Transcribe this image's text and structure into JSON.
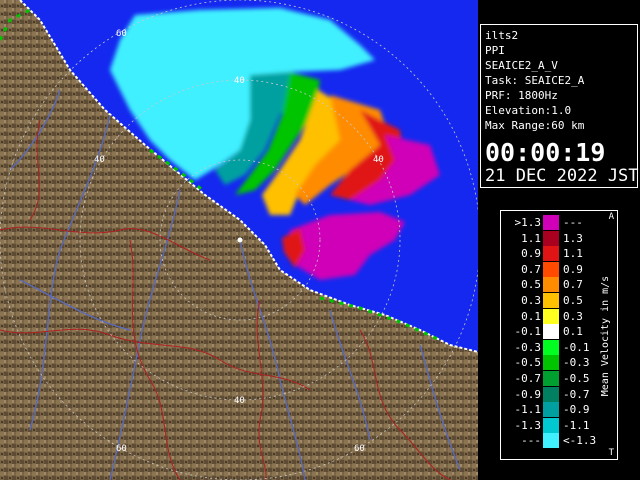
{
  "info": {
    "lines": [
      "ilts2",
      "PPI",
      "SEAICE2_A_V",
      "Task: SEAICE2_A",
      "PRF: 1800Hz",
      "Elevation:1.0",
      "Max Range:60 km"
    ],
    "time": "00:00:19",
    "date": "21 DEC 2022 JST"
  },
  "legend": {
    "unit": "Mean Velocity in m/s",
    "corner_top": "A",
    "corner_bottom": "T",
    "rows": [
      {
        "lo": ">1.3",
        "hi": "---",
        "color": "#d000b8"
      },
      {
        "lo": "1.1",
        "hi": "1.3",
        "color": "#a8001e"
      },
      {
        "lo": "0.9",
        "hi": "1.1",
        "color": "#e01414"
      },
      {
        "lo": "0.7",
        "hi": "0.9",
        "color": "#ff4a00"
      },
      {
        "lo": "0.5",
        "hi": "0.7",
        "color": "#ff8c00"
      },
      {
        "lo": "0.3",
        "hi": "0.5",
        "color": "#ffc000"
      },
      {
        "lo": "0.1",
        "hi": "0.3",
        "color": "#ffff20"
      },
      {
        "lo": "-0.1",
        "hi": "0.1",
        "color": "#ffffff"
      },
      {
        "lo": "-0.3",
        "hi": "-0.1",
        "color": "#00ff20"
      },
      {
        "lo": "-0.5",
        "hi": "-0.3",
        "color": "#00c400"
      },
      {
        "lo": "-0.7",
        "hi": "-0.5",
        "color": "#00a030"
      },
      {
        "lo": "-0.9",
        "hi": "-0.7",
        "color": "#008060"
      },
      {
        "lo": "-1.1",
        "hi": "-0.9",
        "color": "#00a0a0"
      },
      {
        "lo": "-1.3",
        "hi": "-1.1",
        "color": "#00c8d0"
      },
      {
        "lo": "---",
        "hi": "<-1.3",
        "color": "#40f0ff"
      }
    ]
  },
  "range_labels": [
    "60",
    "40",
    "40",
    "40",
    "40",
    "60",
    "60"
  ],
  "colors": {
    "sea": "#1428f0",
    "land": "#7a6446",
    "rings": "#c8c8c8",
    "rivers": "#5a6ab8",
    "boundaries": "#b02020"
  }
}
